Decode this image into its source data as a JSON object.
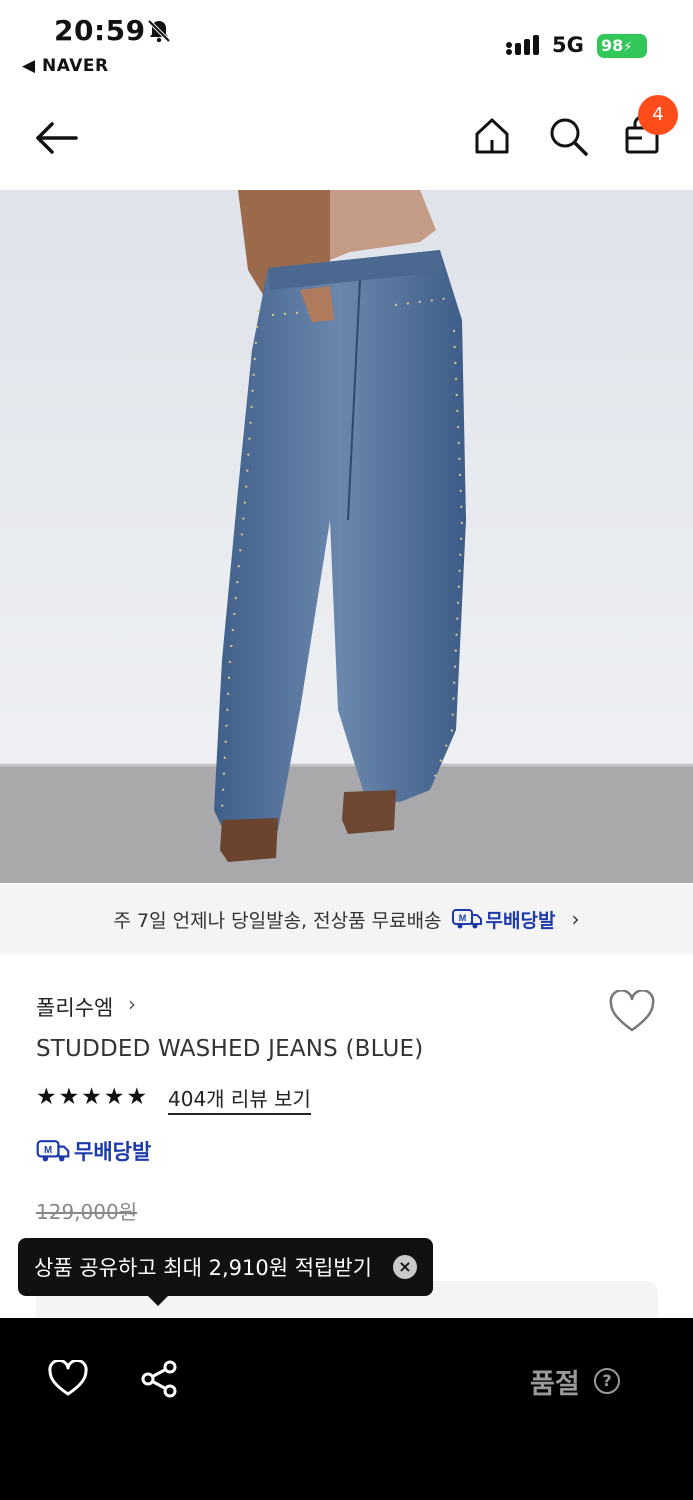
{
  "status_bar": {
    "time": "20:59",
    "back_app": "◀ NAVER",
    "network": "5G",
    "battery": "98"
  },
  "nav": {
    "cart_count": "4"
  },
  "banner": {
    "text": "주 7일 언제나 당일발송, 전상품 무료배송",
    "delivery_label": "무배당발",
    "chevron": "›"
  },
  "product": {
    "brand": "폴리수엠",
    "brand_chevron": "›",
    "title": "STUDDED WASHED JEANS (BLUE)",
    "rating_stars": 5,
    "review_link": "404개 리뷰 보기",
    "delivery_label": "무배당발",
    "original_price": "129,000원"
  },
  "tooltip": {
    "text": "상품 공유하고 최대 2,910원 적립받기",
    "close": "×"
  },
  "bottom_bar": {
    "status": "품절",
    "help": "?"
  },
  "colors": {
    "accent": "#ff4c1b",
    "delivery_blue": "#1c3aa9"
  }
}
